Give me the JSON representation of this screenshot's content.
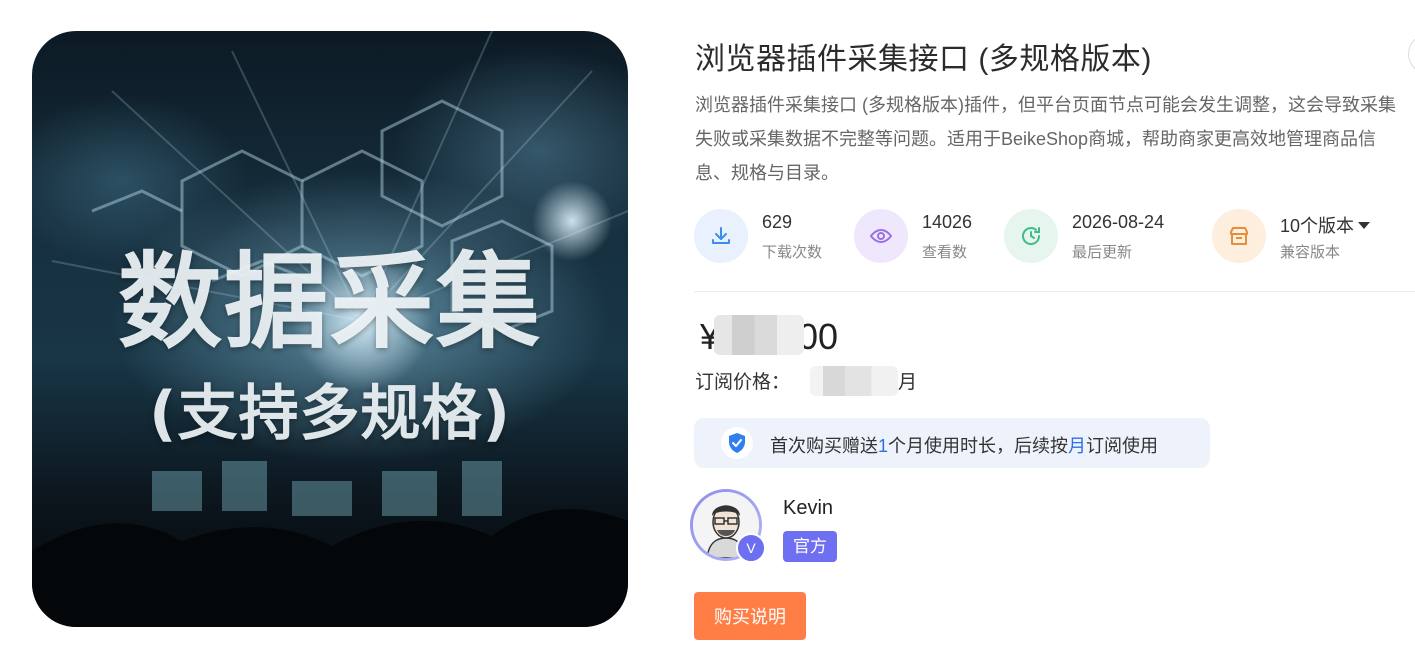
{
  "hero": {
    "title_line1": "数据采集",
    "title_line2": "(支持多规格)"
  },
  "product": {
    "title": "浏览器插件采集接口 (多规格版本)",
    "description": "浏览器插件采集接口 (多规格版本)插件，但平台页面节点可能会发生调整，这会导致采集失败或采集数据不完整等问题。适用于BeikeShop商城，帮助商家更高效地管理商品信息、规格与目录。"
  },
  "stats": [
    {
      "icon": "download-icon",
      "value": "629",
      "label": "下载次数",
      "color": "#3b8cf0",
      "bg": "#e8f1fd"
    },
    {
      "icon": "eye-icon",
      "value": "14026",
      "label": "查看数",
      "color": "#9b6ee8",
      "bg": "#efe8fc"
    },
    {
      "icon": "clock-icon",
      "value": "2026-08-24",
      "label": "最后更新",
      "color": "#3ebd86",
      "bg": "#e6f6ee"
    },
    {
      "icon": "store-icon",
      "value": "10个版本",
      "label": "兼容版本",
      "color": "#e48f3c",
      "bg": "#fdeedd"
    }
  ],
  "pricing": {
    "currency": "¥",
    "price_suffix": "00",
    "subscription_label": "订阅价格：",
    "subscription_prefix": "¥",
    "subscription_suffix": "月"
  },
  "notice": {
    "part1": "首次购买赠送",
    "months": "1",
    "part2": "个月使用时长，后续按",
    "period": "月",
    "part3": "订阅使用",
    "icon": "shield-check-icon",
    "accent": "#2f6fe5"
  },
  "author": {
    "name": "Kevin",
    "badge_letter": "V",
    "tag": "官方"
  },
  "buttons": {
    "buy_info": "购买说明"
  },
  "colors": {
    "accent_orange": "#ff7e45",
    "official_purple": "#6f6ff2"
  }
}
